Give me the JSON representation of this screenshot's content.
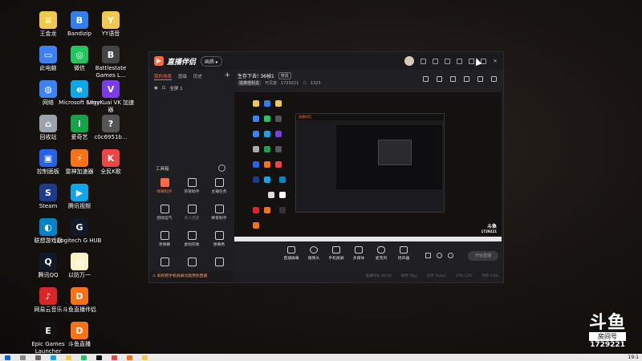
{
  "desktop": {
    "icons": [
      {
        "label": "王金龙",
        "color": "#f2c94c",
        "glyph": "≡"
      },
      {
        "label": "Bandizip",
        "color": "#2f80ed",
        "glyph": "B"
      },
      {
        "label": "YY语音",
        "color": "#f2c94c",
        "glyph": "Y"
      },
      {
        "label": "此电脑",
        "color": "#3b82f6",
        "glyph": "▭"
      },
      {
        "label": "微信",
        "color": "#22c55e",
        "glyph": "◎"
      },
      {
        "label": "Battlestate Games L...",
        "color": "#444",
        "glyph": "B"
      },
      {
        "label": "网络",
        "color": "#3b82f6",
        "glyph": "◍"
      },
      {
        "label": "Microsoft Edge",
        "color": "#0ea5e9",
        "glyph": "e"
      },
      {
        "label": "VeryKuai VK 加速器",
        "color": "#7c3aed",
        "glyph": "V"
      },
      {
        "label": "回收站",
        "color": "#9ca3af",
        "glyph": "⌂"
      },
      {
        "label": "爱奇艺",
        "color": "#16a34a",
        "glyph": "i"
      },
      {
        "label": "c0c6951b...",
        "color": "#555",
        "glyph": "?"
      },
      {
        "label": "控制面板",
        "color": "#2563eb",
        "glyph": "▣"
      },
      {
        "label": "雷神加速器",
        "color": "#f97316",
        "glyph": "⚡"
      },
      {
        "label": "全民K歌",
        "color": "#ef4444",
        "glyph": "K"
      },
      {
        "label": "Steam",
        "color": "#1e3a8a",
        "glyph": "S"
      },
      {
        "label": "腾讯视频",
        "color": "#0ea5e9",
        "glyph": "▶"
      },
      {
        "label": "联想游戏器",
        "color": "#0284c7",
        "glyph": "◐"
      },
      {
        "label": "Logitech G HUB",
        "color": "#111827",
        "glyph": "G"
      },
      {
        "label": "腾讯QQ",
        "color": "#111827",
        "glyph": "Q"
      },
      {
        "label": "以防万一",
        "color": "#fef3c7",
        "glyph": "▤"
      },
      {
        "label": "网易云音乐",
        "color": "#dc2626",
        "glyph": "♪"
      },
      {
        "label": "斗鱼直播伴侣",
        "color": "#f97316",
        "glyph": "D"
      },
      {
        "label": "Epic Games Launcher",
        "color": "#111",
        "glyph": "E"
      },
      {
        "label": "斗鱼直播",
        "color": "#f97316",
        "glyph": "D"
      }
    ]
  },
  "app": {
    "logo_text": "直播伴侣",
    "title_btn": "画质 ▸",
    "sidebar_tabs": [
      "我的场景",
      "层级",
      "历史"
    ],
    "scene_item": "全屏 1",
    "tools_header": "工具箱",
    "tools": [
      {
        "label": "弹幕助手",
        "state": "hot"
      },
      {
        "label": "房管助手",
        "state": "normal"
      },
      {
        "label": "主播任务",
        "state": "normal"
      },
      {
        "label": "招财运气",
        "state": "normal"
      },
      {
        "label": "多人连麦",
        "state": "dim"
      },
      {
        "label": "绑客助手",
        "state": "normal"
      },
      {
        "label": "涂弹幕",
        "state": "normal"
      },
      {
        "label": "虚拟形象",
        "state": "normal"
      },
      {
        "label": "弹幕秀",
        "state": "normal"
      },
      {
        "label": "",
        "state": "normal"
      },
      {
        "label": "",
        "state": "normal"
      },
      {
        "label": "",
        "state": "normal"
      }
    ],
    "stream_title": "生存下去! 36帧1",
    "edit_badge": "修改",
    "category_chip": "逃离塔科夫",
    "room_label": "可见度",
    "room_id": "1729221",
    "viewers": "1323",
    "controls": [
      "直播屏幕",
      "摄像头",
      "手机投屏",
      "多媒体",
      "麦克风",
      "扬声器"
    ],
    "start_button": "开始直播",
    "notice": "如何把手机投屏功能用到直播",
    "status": [
      "直播时长 00:00",
      "帧率 0fps",
      "码率 0kbps",
      "CPU 12%",
      "内存 43%"
    ]
  },
  "watermark": {
    "brand": "斗鱼",
    "room_label": "房间号",
    "room_number": "1729221"
  },
  "taskbar": {
    "time": "19:1"
  }
}
